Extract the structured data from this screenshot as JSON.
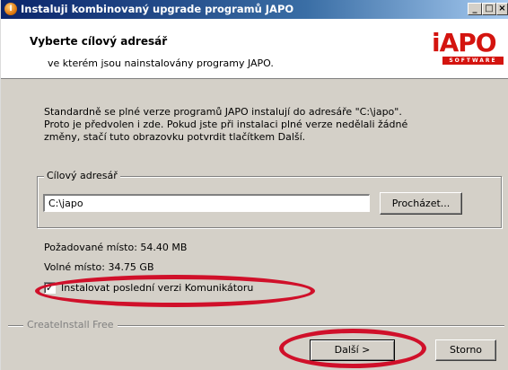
{
  "window": {
    "title": "Instaluji kombinovaný upgrade programů JAPO",
    "app_icon_glyph": "I",
    "buttons": {
      "minimize": "_",
      "maximize": "□",
      "close": "×"
    }
  },
  "header": {
    "title": "Vyberte cílový adresář",
    "subtitle": "ve kterém jsou nainstalovány programy JAPO.",
    "logo": {
      "text": "iAPO",
      "tagline": "SOFTWARE",
      "color": "#d4140f"
    }
  },
  "intro_lines": [
    "Standardně se plné verze programů JAPO instalují do adresáře \"C:\\japo\".",
    "Proto je předvolen i zde. Pokud jste při instalaci plné verze nedělali žádné",
    "změny, stačí tuto obrazovku potvrdit tlačítkem Další."
  ],
  "target_group": {
    "legend": "Cílový adresář",
    "path_value": "C:\\japo",
    "browse_label": "Procházet..."
  },
  "space": {
    "required": "Požadované místo: 54.40 MB",
    "free": "Volné místo: 34.75 GB"
  },
  "checkbox": {
    "label": "Instalovat poslední verzi Komunikátoru",
    "checked": true,
    "mark": "✓"
  },
  "footer": {
    "brand": "CreateInstall Free",
    "next_label": "Další >",
    "cancel_label": "Storno"
  },
  "annotation_color": "#d0102a"
}
